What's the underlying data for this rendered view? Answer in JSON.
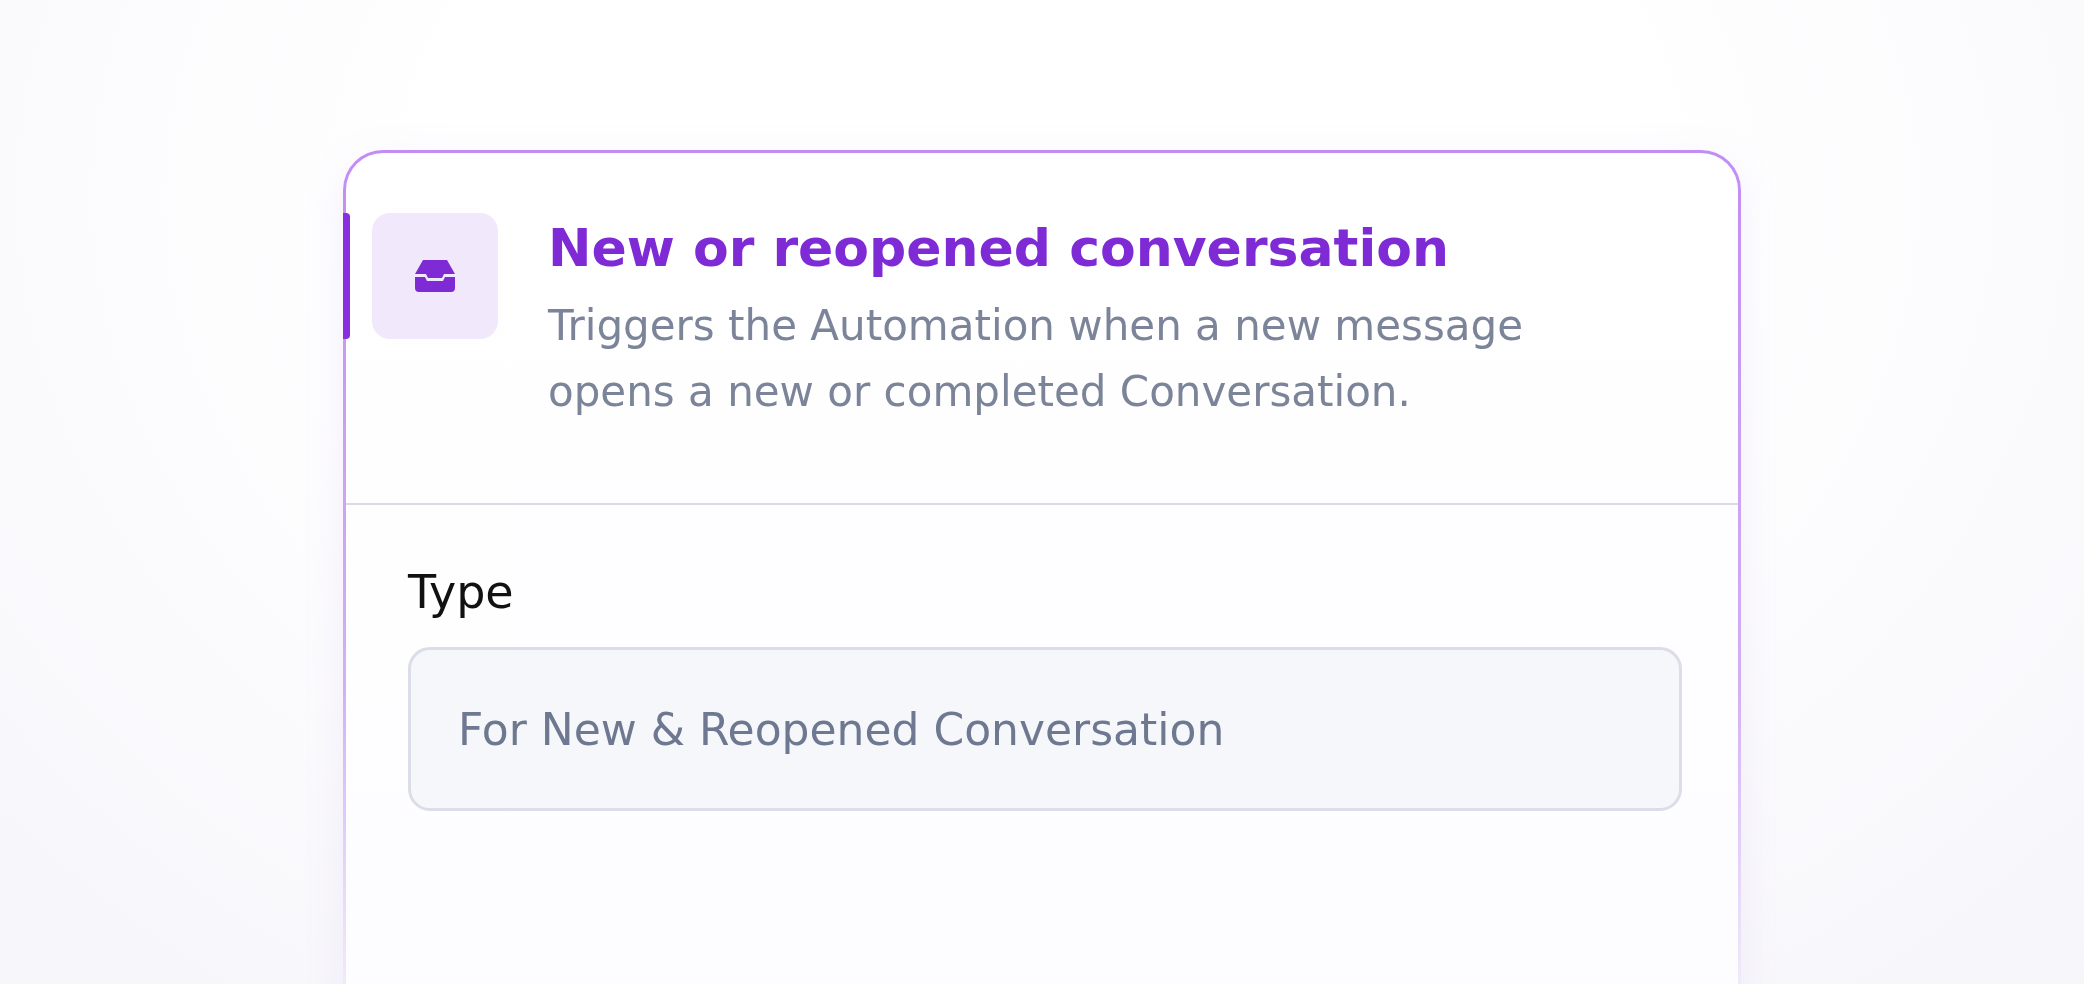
{
  "trigger": {
    "title": "New or reopened conversation",
    "description": "Triggers the Automation when a new message opens a new or completed Conversation.",
    "selected": true
  },
  "field": {
    "label": "Type",
    "value": "For New & Reopened Conversation"
  }
}
